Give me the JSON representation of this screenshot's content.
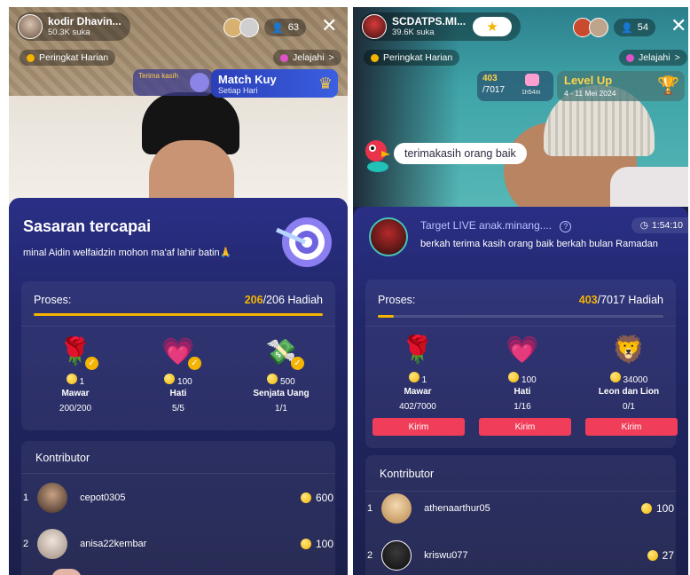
{
  "left": {
    "host_name": "kodir Dhavin...",
    "host_likes": "50.3K suka",
    "viewer_count": "63",
    "close_glyph": "✕",
    "chip_left": "Peringkat Harian",
    "chip_right": "Jelajahi",
    "chip_right_arrow": ">",
    "thanks_text": "Terima kasih",
    "event_title": "Match Kuy",
    "event_sub": "Setiap Hari",
    "goal_title": "Sasaran tercapai",
    "goal_desc": "minal Aidin welfaidzin mohon ma'af lahir batin🙏",
    "progress_label": "Proses:",
    "progress_current": "206",
    "progress_rest": "/206 Hadiah",
    "progress_fraction": 1.0,
    "gifts": [
      {
        "price": "1",
        "name": "Mawar",
        "count": "200/200"
      },
      {
        "price": "100",
        "name": "Hati",
        "count": "5/5"
      },
      {
        "price": "500",
        "name": "Senjata Uang",
        "count": "1/1"
      }
    ],
    "contrib_title": "Kontributor",
    "contributors": [
      {
        "rank": "1",
        "name": "cepot0305",
        "coins": "600"
      },
      {
        "rank": "2",
        "name": "anisa22kembar",
        "coins": "100"
      }
    ]
  },
  "right": {
    "host_name": "SCDATPS.MI...",
    "host_likes": "39.6K suka",
    "viewer_count": "54",
    "close_glyph": "✕",
    "chip_left": "Peringkat Harian",
    "chip_right": "Jelajahi",
    "chip_right_arrow": ">",
    "stat_top": "403",
    "stat_bottom": "/7017",
    "stat_small": "1h54m",
    "level_title": "Level Up",
    "level_dates": "4 - 11 Mei 2024",
    "overlay_text": "terimakasih orang baik",
    "target_title": "Target LIVE anak.minang....",
    "target_help": "?",
    "timer": "1:54:10",
    "target_desc": "berkah terima kasih orang baik berkah bulan Ramadan",
    "progress_label": "Proses:",
    "progress_current": "403",
    "progress_rest": "/7017 Hadiah",
    "progress_fraction": 0.057,
    "gifts": [
      {
        "price": "1",
        "name": "Mawar",
        "count": "402/7000",
        "button": "Kirim"
      },
      {
        "price": "100",
        "name": "Hati",
        "count": "1/16",
        "button": "Kirim"
      },
      {
        "price": "34000",
        "name": "Leon dan Lion",
        "count": "0/1",
        "button": "Kirim"
      }
    ],
    "contrib_title": "Kontributor",
    "contributors": [
      {
        "rank": "1",
        "name": "athenaarthur05",
        "coins": "100"
      },
      {
        "rank": "2",
        "name": "kriswu077",
        "coins": "27"
      }
    ]
  },
  "colors": {
    "accent_gold": "#f5b400",
    "kirim_red": "#f03e5a",
    "card_bg": "#22276a"
  }
}
